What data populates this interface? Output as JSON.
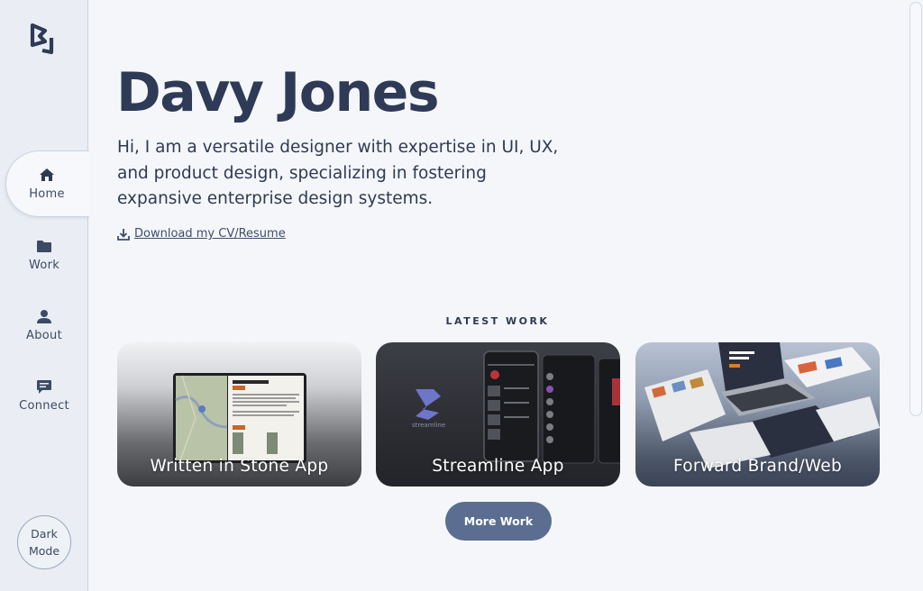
{
  "sidebar": {
    "logo": "dj-logo-icon",
    "items": [
      {
        "label": "Home",
        "icon": "home-icon",
        "active": true
      },
      {
        "label": "Work",
        "icon": "folder-icon",
        "active": false
      },
      {
        "label": "About",
        "icon": "user-icon",
        "active": false
      },
      {
        "label": "Connect",
        "icon": "chat-icon",
        "active": false
      }
    ],
    "dark_mode": {
      "line1": "Dark",
      "line2": "Mode"
    }
  },
  "hero": {
    "title": "Davy Jones",
    "description": "Hi, I am a versatile designer with expertise in UI, UX, and product design, specializing in fostering expansive enterprise design systems.",
    "cv_link": "Download my CV/Resume",
    "cv_icon": "download-icon"
  },
  "latest_work": {
    "heading": "LATEST WORK",
    "cards": [
      {
        "title": "Written in Stone App"
      },
      {
        "title": "Streamline App",
        "logo_text": "streamline"
      },
      {
        "title": "Forward Brand/Web"
      }
    ],
    "more_button": "More Work"
  },
  "colors": {
    "accent": "#5b6e91",
    "sidebar_bg": "#eaeef4",
    "page_bg": "#f4f6fa",
    "heading": "#2e3a56"
  }
}
